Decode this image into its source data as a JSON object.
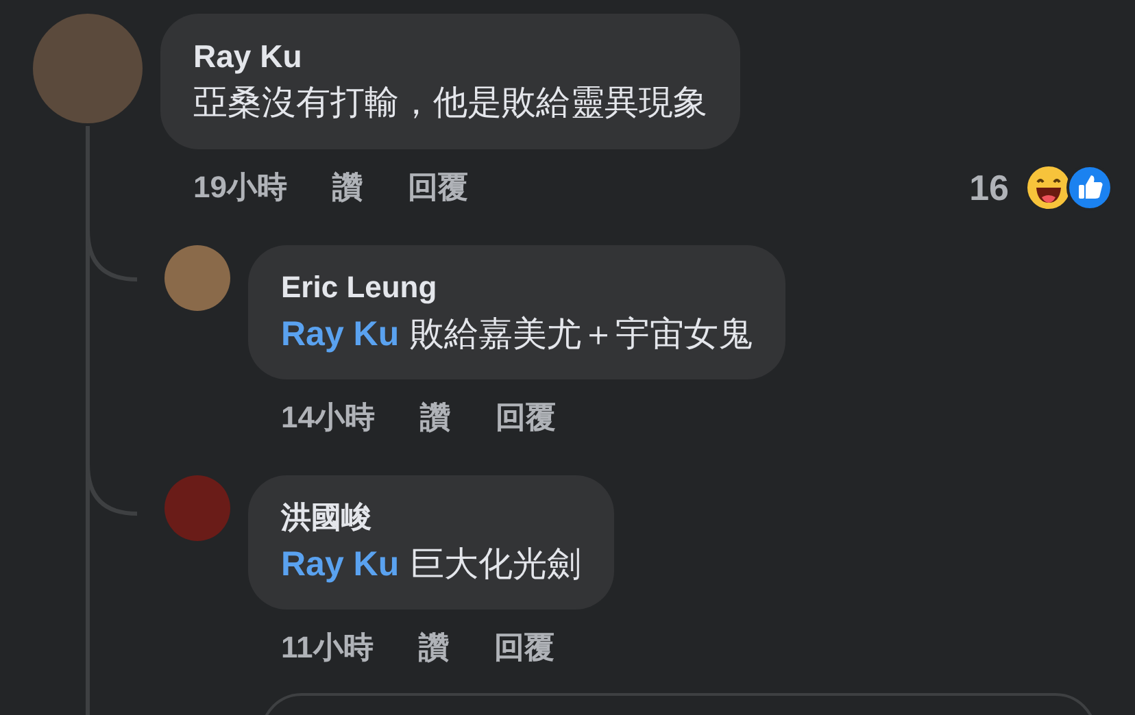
{
  "comment": {
    "author": "Ray Ku",
    "text": "亞桑沒有打輸，他是敗給靈異現象",
    "time": "19小時",
    "like": "讚",
    "reply": "回覆",
    "reaction_count": "16",
    "replies": [
      {
        "author": "Eric Leung",
        "mention": "Ray Ku",
        "text": "敗給嘉美尤＋宇宙女鬼",
        "time": "14小時",
        "like": "讚",
        "reply": "回覆"
      },
      {
        "author": "洪國峻",
        "mention": "Ray Ku",
        "text": "巨大化光劍",
        "time": "11小時",
        "like": "讚",
        "reply": "回覆"
      }
    ]
  }
}
